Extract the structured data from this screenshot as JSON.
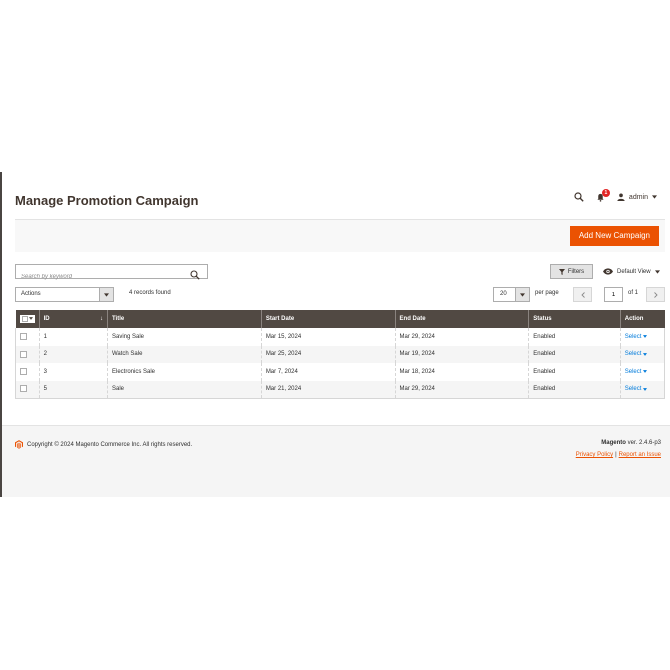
{
  "page": {
    "title": "Manage Promotion Campaign"
  },
  "header": {
    "notifications_count": "1",
    "user": "admin"
  },
  "toolbar": {
    "add_button": "Add New Campaign"
  },
  "grid_controls": {
    "search_placeholder": "Search by keyword",
    "filters_label": "Filters",
    "view_label": "Default View",
    "actions_label": "Actions",
    "records_found": "4 records found",
    "per_page_value": "20",
    "per_page_label": "per page",
    "current_page": "1",
    "page_of": "of 1"
  },
  "table": {
    "columns": [
      "ID",
      "Title",
      "Start Date",
      "End Date",
      "Status",
      "Action"
    ],
    "rows": [
      {
        "id": "1",
        "title": "Saving Sale",
        "start": "Mar 15, 2024",
        "end": "Mar 29, 2024",
        "status": "Enabled",
        "action": "Select"
      },
      {
        "id": "2",
        "title": "Watch Sale",
        "start": "Mar 25, 2024",
        "end": "Mar 19, 2024",
        "status": "Enabled",
        "action": "Select"
      },
      {
        "id": "3",
        "title": "Electronics Sale",
        "start": "Mar 7, 2024",
        "end": "Mar 18, 2024",
        "status": "Enabled",
        "action": "Select"
      },
      {
        "id": "5",
        "title": "Sale",
        "start": "Mar 21, 2024",
        "end": "Mar 29, 2024",
        "status": "Enabled",
        "action": "Select"
      }
    ]
  },
  "footer": {
    "copyright": "Copyright © 2024 Magento Commerce Inc. All rights reserved.",
    "brand": "Magento",
    "version": "ver. 2.4.6-p3",
    "privacy_link": "Privacy Policy",
    "separator": "|",
    "report_link": "Report an Issue"
  },
  "colors": {
    "accent": "#eb5202",
    "header_bg": "#514943",
    "link": "#007bdb"
  },
  "icons": [
    "search-icon",
    "bell-icon",
    "user-icon",
    "filter-icon",
    "eye-icon",
    "chevron-left-icon",
    "chevron-right-icon",
    "magento-logo-icon"
  ]
}
